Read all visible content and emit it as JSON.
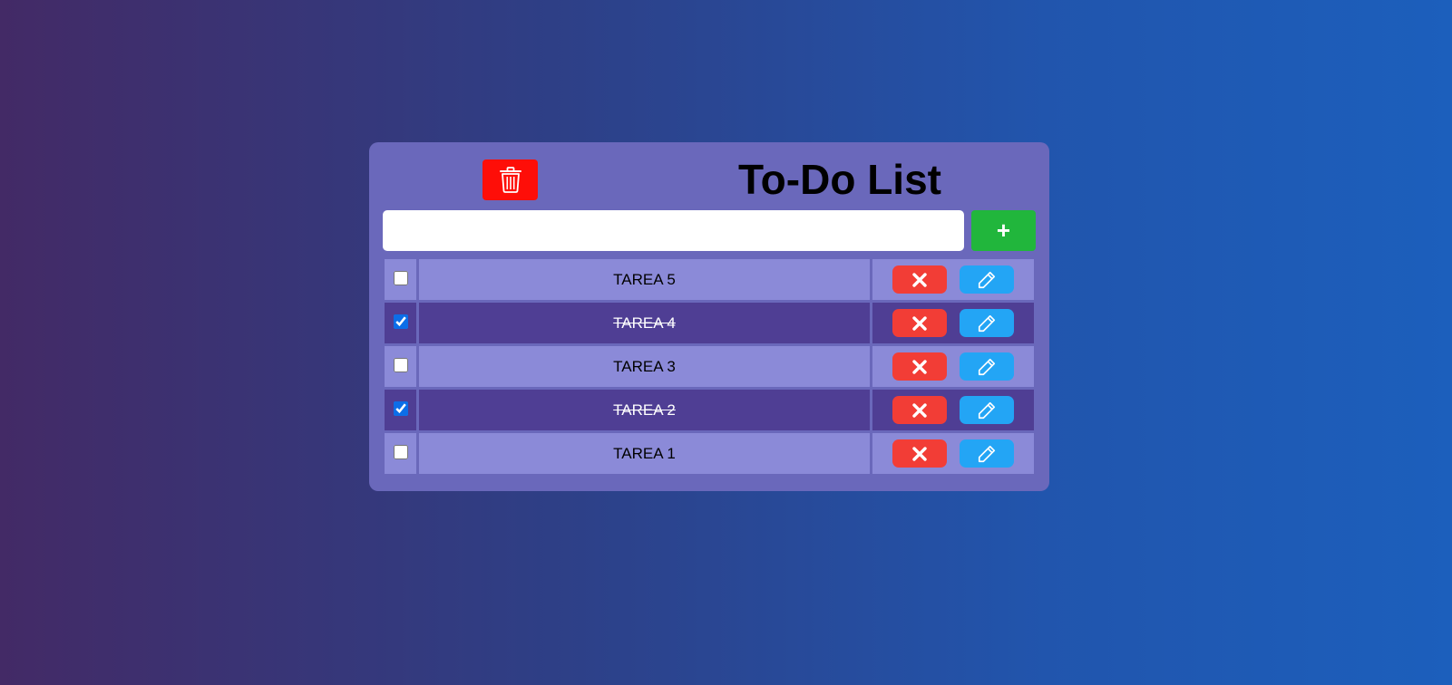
{
  "header": {
    "title": "To-Do List",
    "clear_icon": "trash-icon"
  },
  "form": {
    "input_value": "",
    "input_placeholder": "",
    "add_label": "+"
  },
  "tasks": [
    {
      "label": "TAREA 5",
      "done": false
    },
    {
      "label": "TAREA 4",
      "done": true
    },
    {
      "label": "TAREA 3",
      "done": false
    },
    {
      "label": "TAREA 2",
      "done": true
    },
    {
      "label": "TAREA 1",
      "done": false
    }
  ],
  "row_actions": {
    "delete_icon": "close-x-icon",
    "edit_icon": "pencil-icon"
  },
  "colors": {
    "panel": "#6a68bb",
    "clear_button": "#fe0e08",
    "add_button": "#21b63c",
    "delete_button": "#f23d36",
    "edit_button": "#23a5f5",
    "row_pending": "#8b8ad8",
    "row_done": "#4f3e94"
  }
}
